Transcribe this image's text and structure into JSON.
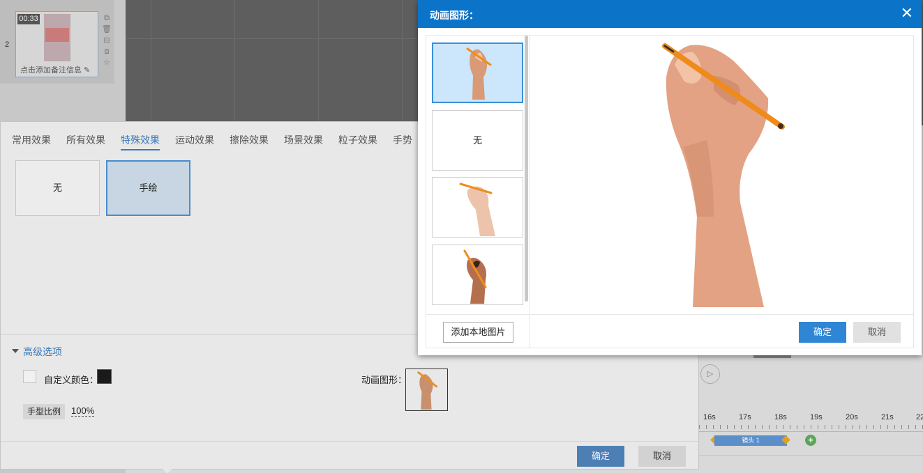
{
  "slide": {
    "number": "2",
    "duration": "00:33",
    "note_placeholder": "点击添加备注信息"
  },
  "effects": {
    "tabs": [
      {
        "label": "常用效果",
        "active": false
      },
      {
        "label": "所有效果",
        "active": false
      },
      {
        "label": "特殊效果",
        "active": true
      },
      {
        "label": "运动效果",
        "active": false
      },
      {
        "label": "擦除效果",
        "active": false
      },
      {
        "label": "场景效果",
        "active": false
      },
      {
        "label": "粒子效果",
        "active": false
      },
      {
        "label": "手势",
        "active": false
      }
    ],
    "options": [
      {
        "label": "无",
        "selected": false
      },
      {
        "label": "手绘",
        "selected": true
      }
    ],
    "advanced": {
      "title": "高级选项",
      "custom_color_label": "自定义颜色：",
      "custom_color_value": "#1a1a1a",
      "custom_color_checked": false,
      "hand_scale_label": "手型比例",
      "hand_scale_value": "100%",
      "anim_shape_label": "动画图形："
    },
    "ok_label": "确定",
    "cancel_label": "取消"
  },
  "timeline": {
    "ticks": [
      "16s",
      "17s",
      "18s",
      "19s",
      "20s",
      "21s",
      "22"
    ],
    "clip_label": "镜头 1"
  },
  "dialog": {
    "title": "动画图形：",
    "close_icon": "close-icon",
    "items": [
      {
        "label": "",
        "kind": "hand-pencil-upright",
        "selected": true
      },
      {
        "label": "无",
        "kind": "none",
        "selected": false
      },
      {
        "label": "",
        "kind": "hand-pencil-relaxed",
        "selected": false
      },
      {
        "label": "",
        "kind": "hand-pencil-dark",
        "selected": false
      }
    ],
    "add_local_label": "添加本地图片",
    "ok_label": "确定",
    "cancel_label": "取消"
  },
  "colors": {
    "accent": "#0b73c8",
    "primary_button": "#2f86d5",
    "skin": "#e8a98a",
    "pencil": "#f08c1a"
  }
}
